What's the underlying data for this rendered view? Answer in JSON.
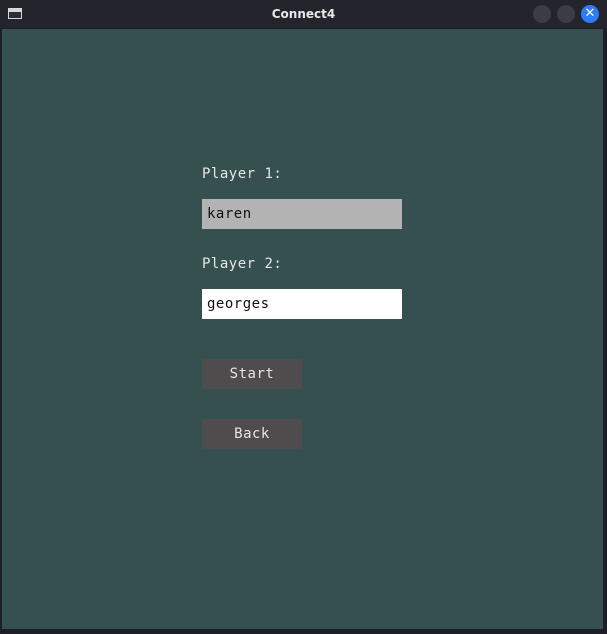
{
  "window": {
    "title": "Connect4",
    "close_glyph": "✕",
    "icons": {
      "app": "window-icon",
      "minimize": "minimize-icon",
      "maximize": "maximize-icon",
      "close": "close-icon"
    },
    "colors": {
      "background": "#364f4f",
      "titlebar": "#23242c",
      "close_button": "#2f7bf6",
      "button": "#4e4c4c"
    }
  },
  "form": {
    "player1": {
      "label": "Player 1:",
      "value": "karen"
    },
    "player2": {
      "label": "Player 2:",
      "value": "georges"
    },
    "start_label": "Start",
    "back_label": "Back"
  }
}
